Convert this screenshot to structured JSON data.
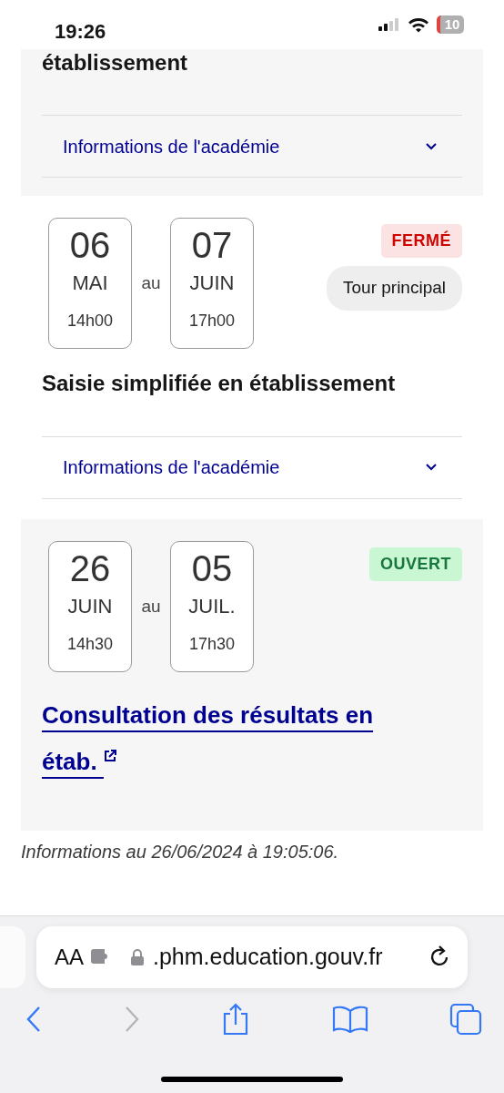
{
  "status_bar": {
    "time": "19:26",
    "battery": "10",
    "battery_low": true
  },
  "sessions": [
    {
      "kind": "partial",
      "title": "établissement",
      "accordion": "Informations de l'académie"
    },
    {
      "kind": "session",
      "start": {
        "day": "06",
        "month": "MAI",
        "time": "14h00"
      },
      "separator": "au",
      "end": {
        "day": "07",
        "month": "JUIN",
        "time": "17h00"
      },
      "status": {
        "label": "FERMÉ",
        "kind": "closed"
      },
      "tag": "Tour principal",
      "title": "Saisie simplifiée en établissement",
      "accordion": "Informations de l'académie"
    },
    {
      "kind": "session",
      "start": {
        "day": "26",
        "month": "JUIN",
        "time": "14h30"
      },
      "separator": "au",
      "end": {
        "day": "05",
        "month": "JUIL.",
        "time": "17h30"
      },
      "status": {
        "label": "OUVERT",
        "kind": "open"
      },
      "link": "Consultation des résultats en étab."
    }
  ],
  "footer": "Informations au 26/06/2024 à 19:05:06.",
  "browser": {
    "text_size": "AA",
    "url": ".phm.education.gouv.fr",
    "back_disabled": false,
    "forward_disabled": true
  }
}
